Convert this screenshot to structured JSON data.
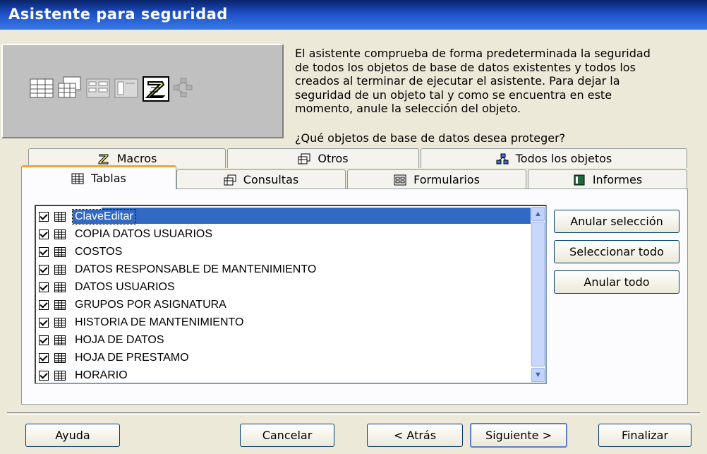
{
  "window": {
    "title": "Asistente para seguridad"
  },
  "preview_icons": [
    "table-icon",
    "query-icon",
    "form-icon",
    "report-icon",
    "macro-icon",
    "module-icon"
  ],
  "description": {
    "lines": [
      "El asistente comprueba de forma predeterminada la seguridad",
      "de todos los objetos de base de datos existentes y todos los",
      "creados al terminar de ejecutar el asistente. Para dejar la",
      "seguridad de un objeto tal y como se encuentra en este",
      "momento, anule la selección del objeto."
    ],
    "question": "¿Qué objetos de base de datos desea proteger?"
  },
  "tabs": {
    "back_row": [
      {
        "label": "Macros",
        "icon": "macro-icon"
      },
      {
        "label": "Otros",
        "icon": "other-icon"
      },
      {
        "label": "Todos los objetos",
        "icon": "all-objects-icon"
      }
    ],
    "front_row": [
      {
        "label": "Tablas",
        "icon": "table-icon",
        "active": true
      },
      {
        "label": "Consultas",
        "icon": "query-icon"
      },
      {
        "label": "Formularios",
        "icon": "form-icon"
      },
      {
        "label": "Informes",
        "icon": "report-icon"
      }
    ]
  },
  "list": {
    "items": [
      {
        "label": "ClaveEditar",
        "checked": true,
        "selected": true
      },
      {
        "label": "COPIA DATOS USUARIOS",
        "checked": true
      },
      {
        "label": "COSTOS",
        "checked": true
      },
      {
        "label": "DATOS RESPONSABLE DE MANTENIMIENTO",
        "checked": true
      },
      {
        "label": "DATOS USUARIOS",
        "checked": true
      },
      {
        "label": "GRUPOS POR ASIGNATURA",
        "checked": true
      },
      {
        "label": "HISTORIA DE MANTENIMIENTO",
        "checked": true
      },
      {
        "label": "HOJA DE DATOS",
        "checked": true
      },
      {
        "label": "HOJA DE PRESTAMO",
        "checked": true
      },
      {
        "label": "HORARIO",
        "checked": true
      }
    ]
  },
  "side_buttons": {
    "deselect": "Anular selección",
    "select_all": "Seleccionar todo",
    "clear_all": "Anular todo"
  },
  "footer": {
    "help": "Ayuda",
    "cancel": "Cancelar",
    "back": "< Atrás",
    "next": "Siguiente >",
    "finish": "Finalizar"
  }
}
